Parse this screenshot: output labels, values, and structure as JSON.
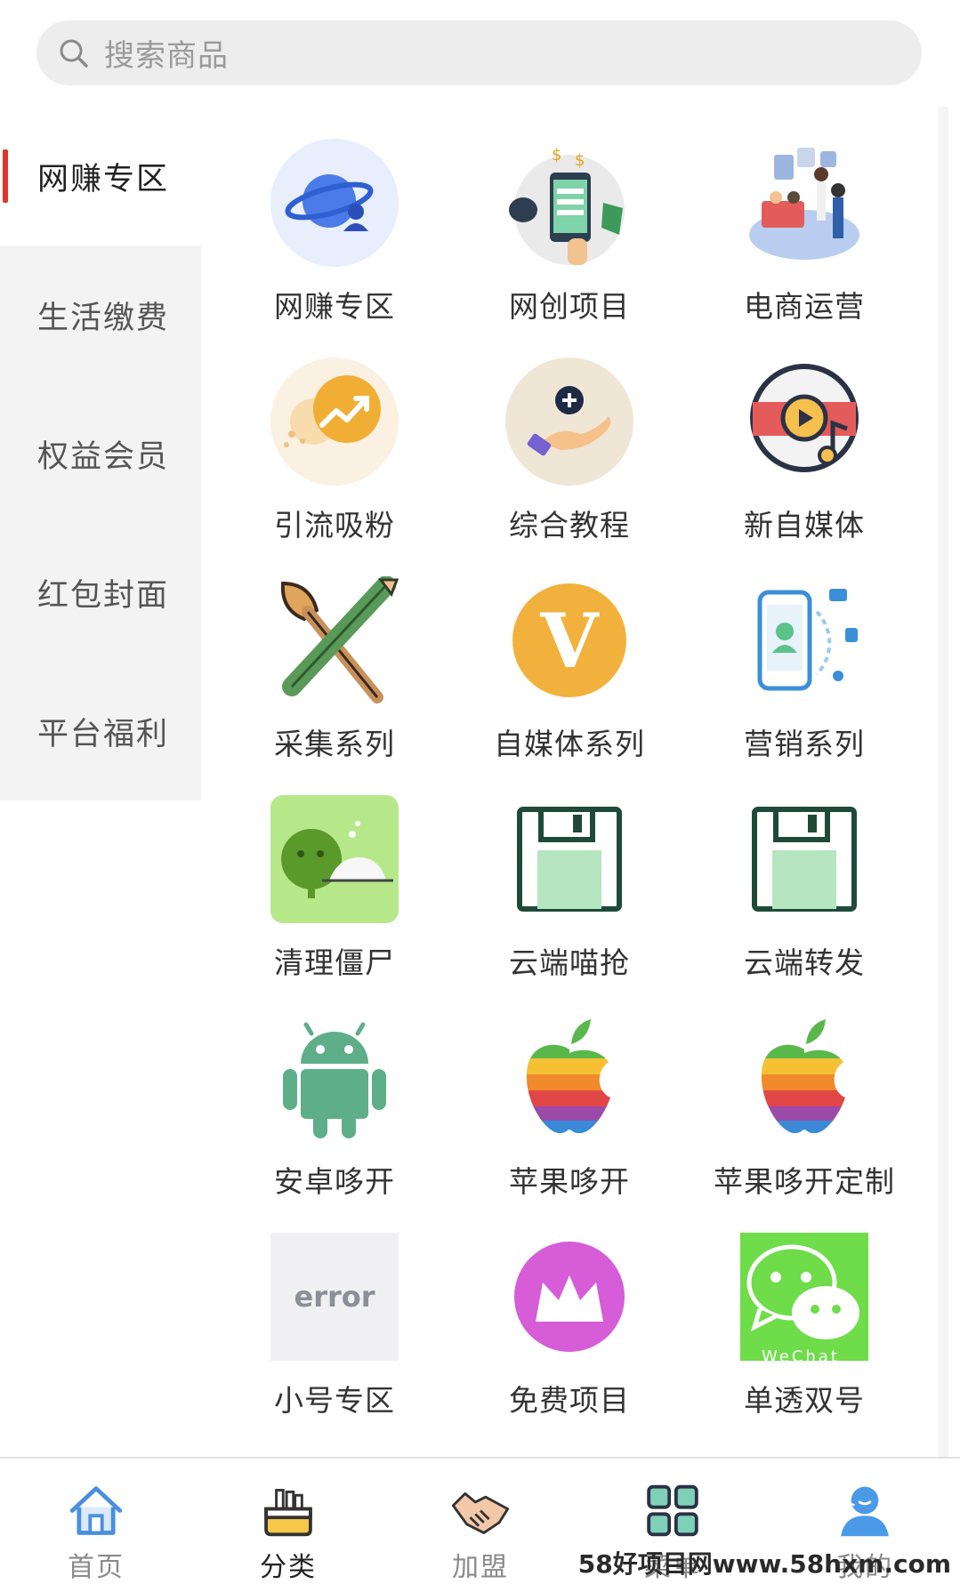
{
  "search": {
    "placeholder": "搜索商品"
  },
  "sidebar": {
    "items": [
      {
        "label": "网赚专区",
        "active": true
      },
      {
        "label": "生活缴费",
        "active": false
      },
      {
        "label": "权益会员",
        "active": false
      },
      {
        "label": "红包封面",
        "active": false
      },
      {
        "label": "平台福利",
        "active": false
      }
    ]
  },
  "grid": {
    "items": [
      {
        "label": "网赚专区",
        "icon": "globe-user-icon"
      },
      {
        "label": "网创项目",
        "icon": "phone-money-icon"
      },
      {
        "label": "电商运营",
        "icon": "ecommerce-people-icon"
      },
      {
        "label": "引流吸粉",
        "icon": "growth-arrow-icon"
      },
      {
        "label": "综合教程",
        "icon": "hand-plus-icon"
      },
      {
        "label": "新自媒体",
        "icon": "media-play-icon"
      },
      {
        "label": "采集系列",
        "icon": "brush-pencil-icon"
      },
      {
        "label": "自媒体系列",
        "icon": "v-badge-icon"
      },
      {
        "label": "营销系列",
        "icon": "phone-marketing-icon"
      },
      {
        "label": "清理僵尸",
        "icon": "wechat-clean-icon"
      },
      {
        "label": "云端喵抢",
        "icon": "floppy-disk-icon"
      },
      {
        "label": "云端转发",
        "icon": "floppy-disk-icon"
      },
      {
        "label": "安卓哆开",
        "icon": "android-icon"
      },
      {
        "label": "苹果哆开",
        "icon": "apple-icon"
      },
      {
        "label": "苹果哆开定制",
        "icon": "apple-icon"
      },
      {
        "label": "小号专区",
        "icon": "error-image-icon",
        "icon_text": "error"
      },
      {
        "label": "免费项目",
        "icon": "crown-icon"
      },
      {
        "label": "单透双号",
        "icon": "wechat-icon",
        "icon_text": "WeChat"
      }
    ]
  },
  "tabbar": {
    "items": [
      {
        "label": "首页",
        "icon": "home-icon",
        "active": false
      },
      {
        "label": "分类",
        "icon": "category-box-icon",
        "active": true
      },
      {
        "label": "加盟",
        "icon": "handshake-icon",
        "active": false
      },
      {
        "label": "菜单",
        "icon": "grid-menu-icon",
        "active": false
      },
      {
        "label": "我的",
        "icon": "user-icon",
        "active": false
      }
    ]
  },
  "watermark": "58好项目网www.58hxm.com",
  "colors": {
    "accent": "#e0352b",
    "sidebar_bg": "#f3f3f3",
    "search_bg": "#ededed"
  }
}
